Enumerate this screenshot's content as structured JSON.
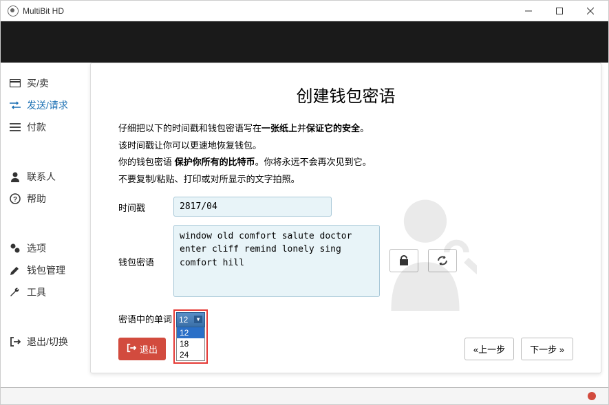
{
  "titlebar": {
    "app_name": "MultiBit HD"
  },
  "sidebar": {
    "items": [
      {
        "label": "买/卖"
      },
      {
        "label": "发送/请求"
      },
      {
        "label": "付款"
      },
      {
        "label": "联系人"
      },
      {
        "label": "帮助"
      },
      {
        "label": "选项"
      },
      {
        "label": "钱包管理"
      },
      {
        "label": "工具"
      },
      {
        "label": "退出/切换"
      }
    ]
  },
  "modal": {
    "title": "创建钱包密语",
    "instr_line1_a": "仔细把以下的时间戳和钱包密语写在",
    "instr_line1_b": "一张纸上",
    "instr_line1_c": "并",
    "instr_line1_d": "保证它的安全",
    "instr_line1_e": "。",
    "instr_line2": "该时间戳让你可以更速地恢复钱包。",
    "instr_line3_a": "你的钱包密语 ",
    "instr_line3_b": "保护你所有的比特币",
    "instr_line3_c": "。你将永远不会再次见到它。",
    "instr_line4": "不要复制/粘贴、打印或对所显示的文字拍照。",
    "timestamp_label": "时间戳",
    "timestamp_value": "2817/04",
    "words_label": "钱包密语",
    "words_value": "window old comfort salute doctor enter cliff remind lonely sing\ncomfort hill",
    "count_label": "密语中的单词",
    "dropdown": {
      "selected": "12",
      "options": [
        "12",
        "18",
        "24"
      ]
    },
    "exit_label": "退出",
    "prev_label": "上一步",
    "next_label": "下一步",
    "prev_arrows": "«",
    "next_arrows": "»"
  }
}
